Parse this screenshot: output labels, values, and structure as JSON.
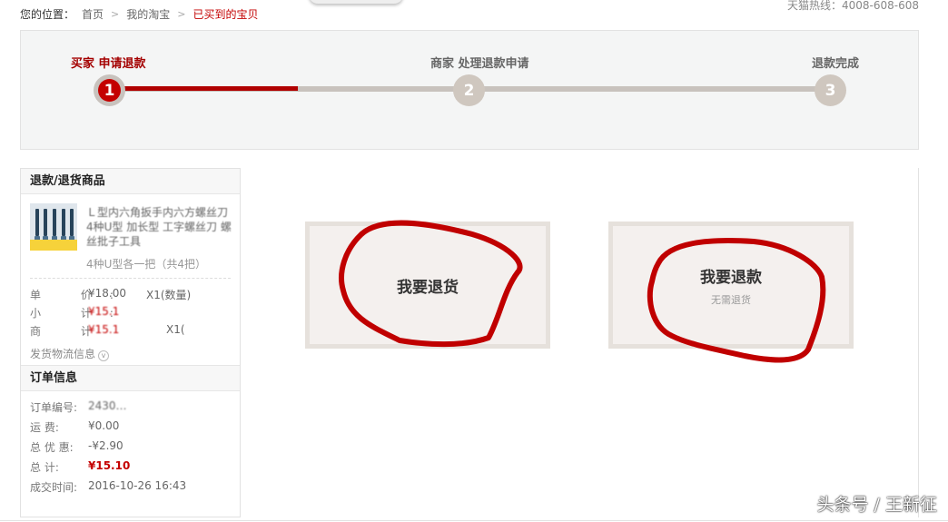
{
  "breadcrumb": {
    "prefix": "您的位置：",
    "items": [
      "首页",
      "我的淘宝"
    ],
    "current": "已买到的宝贝"
  },
  "hotline": "天猫热线：4008-608-608",
  "steps": [
    {
      "num": "1",
      "label": "买家 申请退款",
      "active": true
    },
    {
      "num": "2",
      "label": "商家 处理退款申请",
      "active": false
    },
    {
      "num": "3",
      "label": "退款完成",
      "active": false
    }
  ],
  "progress_fraction": 0.26,
  "refund_goods": {
    "heading": "退款/退货商品",
    "product_name": "Ｌ型内六角扳手内六方螺丝刀 4种U型 加长型 工字螺丝刀 螺丝批子工具",
    "spec": "4种U型各一把（共4把）",
    "unit_price_label": "单  价:",
    "unit_price": "¥18.00",
    "quantity": "X1(数量)",
    "subtotal_label": "小  计:",
    "subtotal": "¥15.1",
    "goods_label": "商  计",
    "goods_value": "¥15.1",
    "goods_qty": "X1(",
    "logistics_link": "发货物流信息"
  },
  "order_info": {
    "heading": "订单信息",
    "order_no_label": "订单编号:",
    "order_no": "2430…",
    "shipping_label": "运    费:",
    "shipping": "¥0.00",
    "discount_label": "总 优 惠:",
    "discount": "-¥2.90",
    "total_label": "总    计:",
    "total": "¥15.10",
    "time_label": "成交时间:",
    "time": "2016-10-26 16:43"
  },
  "options": {
    "return_goods": {
      "title": "我要退货"
    },
    "refund_only": {
      "title": "我要退款",
      "subtitle": "无需退货"
    }
  },
  "colors": {
    "accent": "#c40000",
    "annotation": "#c00000"
  },
  "watermark": "头条号 / 王新征"
}
